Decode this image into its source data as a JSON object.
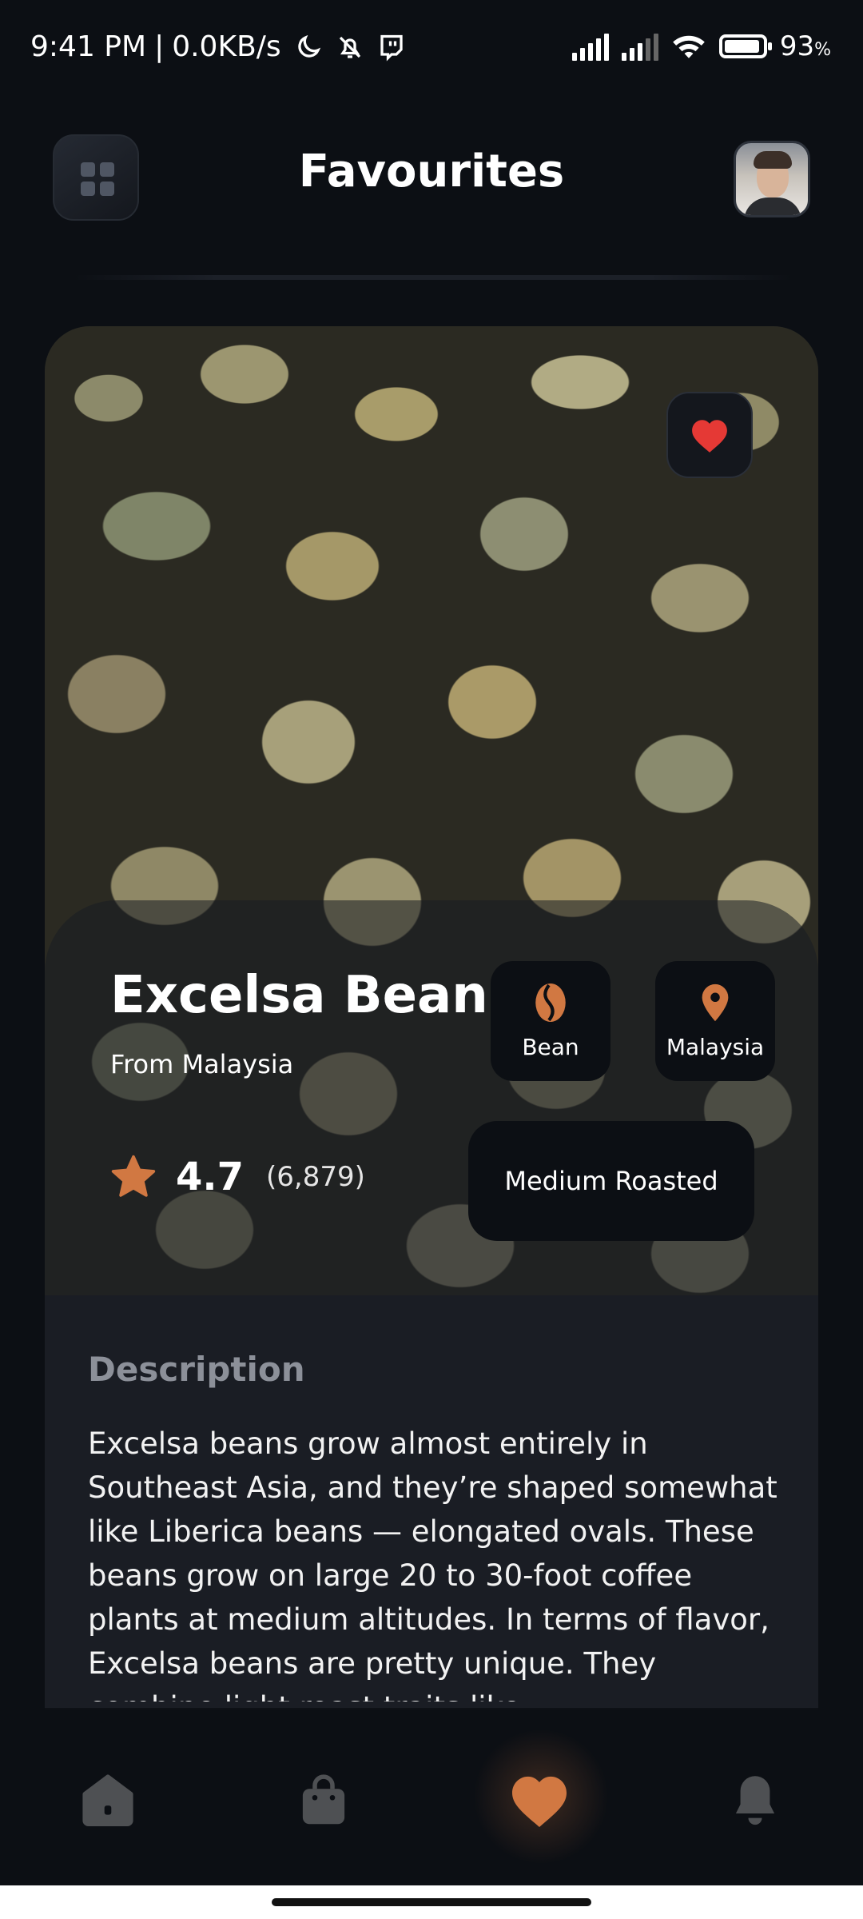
{
  "status_bar": {
    "time": "9:41 PM",
    "separator": "|",
    "network_speed": "0.0KB/s",
    "battery_percent": "93",
    "battery_unit": "%",
    "battery_level": 0.93,
    "icons": [
      "moon-icon",
      "bell-off-icon",
      "twitch-icon",
      "signal-icon",
      "signal-icon",
      "wifi-icon",
      "battery-icon"
    ]
  },
  "header": {
    "title": "Favourites",
    "menu_icon": "grid-icon",
    "avatar": "avatar"
  },
  "product": {
    "name": "Excelsa Beans",
    "origin": "From Malaysia",
    "rating": "4.7",
    "ratings_count": "(6,879)",
    "favourite_icon": "heart-icon",
    "chips": {
      "type": "Bean",
      "country": "Malaysia",
      "roast": "Medium Roasted"
    }
  },
  "description": {
    "title": "Description",
    "text": "Excelsa beans grow almost entirely in Southeast Asia, and they’re shaped somewhat like Liberica beans — elongated ovals. These beans grow on large 20 to 30-foot coffee plants at medium altitudes. In terms of flavor, Excelsa beans are pretty unique. They combine light roast traits like"
  },
  "bottom_nav": {
    "items": [
      "home-icon",
      "bag-icon",
      "heart-icon",
      "bell-icon"
    ],
    "active": "heart-icon"
  },
  "colors": {
    "accent": "#D17842",
    "background": "#0C0F14",
    "card": "#1A1D24",
    "muted_text": "#8C9099",
    "heart_red": "#E53935",
    "inactive_icon": "#4E5053"
  }
}
